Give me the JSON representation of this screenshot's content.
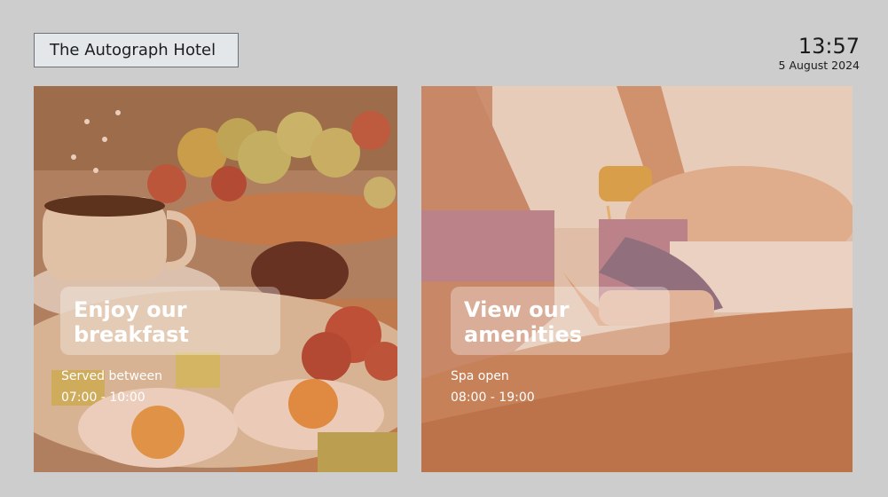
{
  "header": {
    "hotel_name": "The Autograph Hotel",
    "time": "13:57",
    "date": "5 August 2024"
  },
  "cards": [
    {
      "title_line1": "Enjoy our",
      "title_line2": "breakfast",
      "subtitle_line1": "Served between",
      "subtitle_line2": "07:00 - 10:00",
      "image": "breakfast-photo"
    },
    {
      "title_line1": "View our",
      "title_line2": "amenities",
      "subtitle_line1": "Spa open",
      "subtitle_line2": "08:00 - 19:00",
      "image": "spa-massage-photo"
    }
  ],
  "colors": {
    "background": "#cdcdce",
    "badge_background": "#e3e7ea",
    "badge_border": "#6d7378",
    "image_tint": "#d6783c"
  }
}
